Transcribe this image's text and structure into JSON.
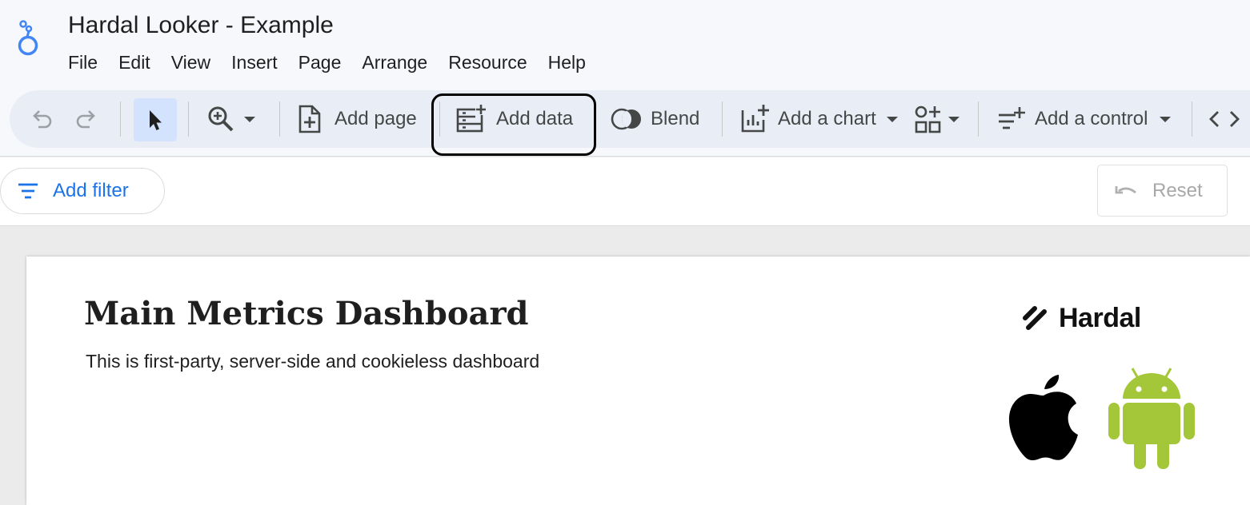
{
  "app": {
    "title": "Hardal Looker - Example"
  },
  "menu": [
    "File",
    "Edit",
    "View",
    "Insert",
    "Page",
    "Arrange",
    "Resource",
    "Help"
  ],
  "toolbar": {
    "add_page": "Add page",
    "add_data": "Add data",
    "blend": "Blend",
    "add_chart": "Add a chart",
    "add_control": "Add a control"
  },
  "filterbar": {
    "add_filter": "Add filter",
    "reset": "Reset"
  },
  "dashboard": {
    "title": "Main Metrics Dashboard",
    "subtitle": "This is first-party, server-side and cookieless dashboard",
    "brand": "Hardal"
  },
  "colors": {
    "accent": "#1a73e8",
    "selected": "#d3e3fd",
    "android": "#a4c639"
  }
}
